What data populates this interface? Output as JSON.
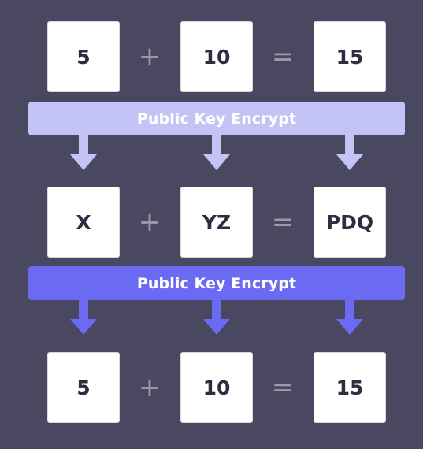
{
  "rows": [
    {
      "left": "5",
      "plus": "+",
      "middle": "10",
      "equals": "=",
      "right": "15"
    },
    {
      "left": "X",
      "plus": "+",
      "middle": "YZ",
      "equals": "=",
      "right": "PDQ"
    },
    {
      "left": "5",
      "plus": "+",
      "middle": "10",
      "equals": "=",
      "right": "15"
    }
  ],
  "bands": [
    {
      "label": "Public Key Encrypt",
      "color": "#c3c3f6"
    },
    {
      "label": "Public Key Encrypt",
      "color": "#6a6af2"
    }
  ],
  "colors": {
    "background": "#4a4860",
    "box": "#ffffff",
    "operator": "#9b99ad",
    "text": "#2f2d3f"
  }
}
